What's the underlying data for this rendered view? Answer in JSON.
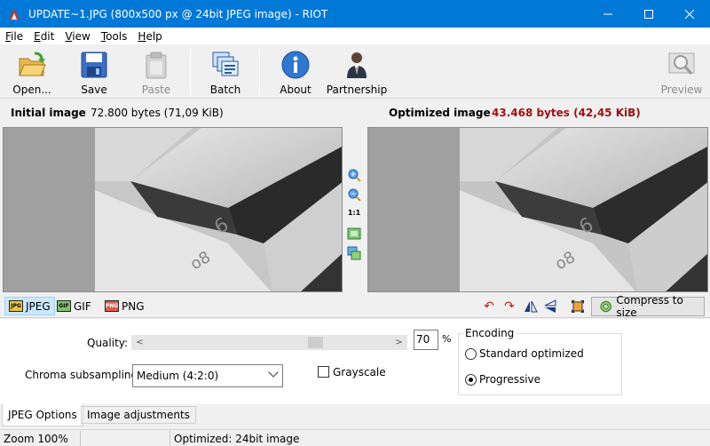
{
  "window": {
    "title": "UPDATE~1.JPG (800x500 px @ 24bit JPEG image) - RIOT",
    "controls": [
      "minimize-icon",
      "maximize-icon",
      "close-icon"
    ],
    "accent": "#0078d7"
  },
  "menu": {
    "items": [
      {
        "key": "F",
        "rest": "ile"
      },
      {
        "key": "E",
        "rest": "dit"
      },
      {
        "key": "V",
        "rest": "iew"
      },
      {
        "key": "T",
        "rest": "ools"
      },
      {
        "key": "H",
        "rest": "elp"
      }
    ]
  },
  "toolbar": {
    "open": "Open...",
    "save": "Save",
    "paste": "Paste",
    "batch": "Batch",
    "about": "About",
    "partnership": "Partnership",
    "preview": "Preview"
  },
  "images": {
    "initial_label": "Initial image",
    "initial_size": "72.800 bytes (71,09 KiB)",
    "optimized_label": "Optimized image",
    "optimized_size": "43.468 bytes (42,45 KiB)",
    "optimized_color": "#a01010"
  },
  "zoom_tools": {
    "one_to_one": "1:1"
  },
  "formats": {
    "jpeg": "JPEG",
    "gif": "GIF",
    "png": "PNG",
    "jpeg_icon": "JPG",
    "gif_icon": "GIF",
    "png_icon": "PNG",
    "selected": "JPEG"
  },
  "compress": {
    "label": "Compress to size"
  },
  "jpeg_options": {
    "quality_label": "Quality:",
    "quality_value": "70",
    "quality_unit": "%",
    "quality_level_percent": 70,
    "chroma_label": "Chroma subsampling:",
    "chroma_value": "Medium (4:2:0)",
    "grayscale_label": "Grayscale",
    "grayscale_checked": false,
    "encoding_title": "Encoding",
    "encoding_options": [
      "Standard optimized",
      "Progressive"
    ],
    "encoding_selected": "Progressive"
  },
  "bottom_tabs": {
    "jpeg_options": "JPEG Options",
    "image_adjustments": "Image adjustments"
  },
  "status": {
    "zoom": "Zoom 100%",
    "empty": "",
    "message": "Optimized: 24bit  image"
  }
}
